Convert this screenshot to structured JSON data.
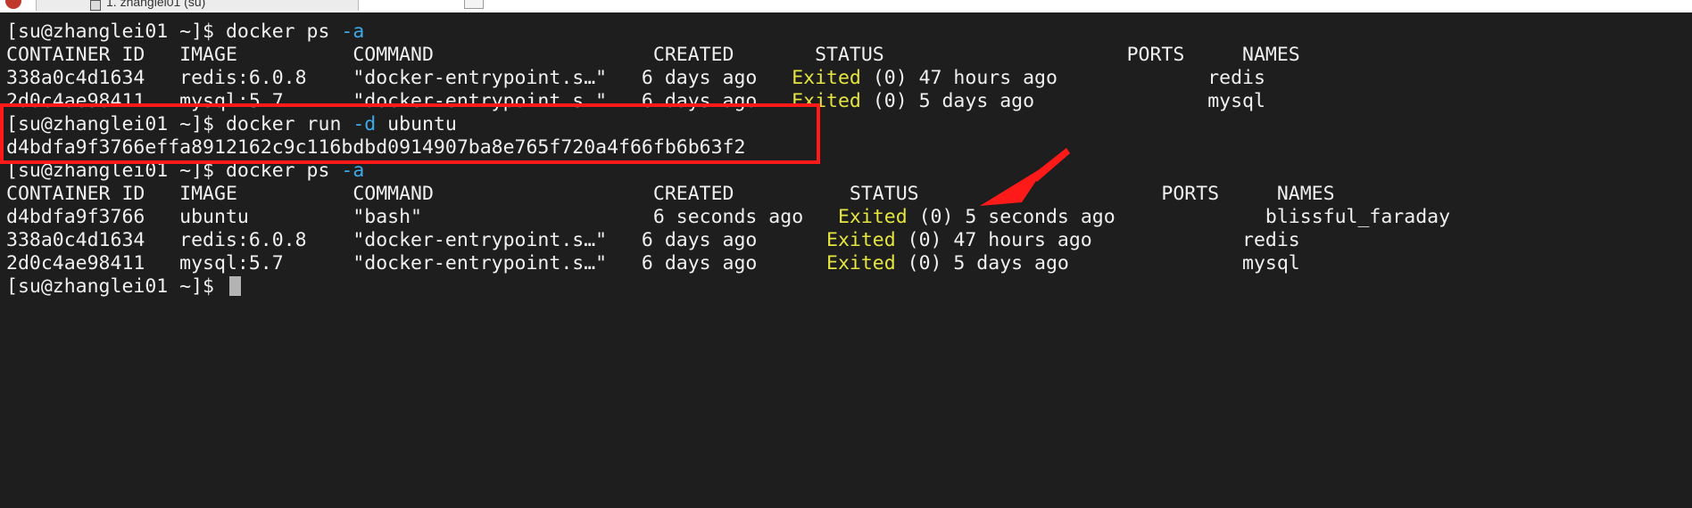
{
  "tabs": {
    "active_title": "1. zhanglei01 (su)"
  },
  "terminal": {
    "lines": [
      {
        "prompt": "[su@zhanglei01 ~]$ ",
        "command": "docker ps ",
        "option": "-a"
      },
      {
        "text": "CONTAINER ID   IMAGE          COMMAND                   CREATED       STATUS                     PORTS     NAMES"
      },
      {
        "pre": "338a0c4d1634   redis:6.0.8    \"docker-entrypoint.s…\"   6 days ago   ",
        "status": "Exited",
        "post": " (0) 47 hours ago             redis"
      },
      {
        "pre": "2d0c4ae98411   mysql:5.7      \"docker-entrypoint.s…\"   6 days ago   ",
        "status": "Exited",
        "post": " (0) 5 days ago               mysql"
      },
      {
        "prompt": "[su@zhanglei01 ~]$ ",
        "command": "docker run ",
        "option": "-d",
        "rest": " ubuntu"
      },
      {
        "text": "d4bdfa9f3766effa8912162c9c116bdbd0914907ba8e765f720a4f66fb6b63f2"
      },
      {
        "prompt": "[su@zhanglei01 ~]$ ",
        "command": "docker ps ",
        "option": "-a"
      },
      {
        "text": "CONTAINER ID   IMAGE          COMMAND                   CREATED          STATUS                     PORTS     NAMES"
      },
      {
        "pre": "d4bdfa9f3766   ubuntu         \"bash\"                    6 seconds ago   ",
        "status": "Exited",
        "post": " (0) 5 seconds ago             blissful_faraday"
      },
      {
        "pre": "338a0c4d1634   redis:6.0.8    \"docker-entrypoint.s…\"   6 days ago      ",
        "status": "Exited",
        "post": " (0) 47 hours ago             redis"
      },
      {
        "pre": "2d0c4ae98411   mysql:5.7      \"docker-entrypoint.s…\"   6 days ago      ",
        "status": "Exited",
        "post": " (0) 5 days ago               mysql"
      },
      {
        "prompt": "[su@zhanglei01 ~]$ "
      }
    ]
  },
  "colors": {
    "background": "#1e1e1e",
    "text": "#f0f0f0",
    "option": "#3fa9e8",
    "status": "#e5e540",
    "annotation": "#ff1a1a"
  },
  "icons": {
    "annotation_arrow": "red-arrow-icon",
    "cursor": "block-cursor"
  }
}
